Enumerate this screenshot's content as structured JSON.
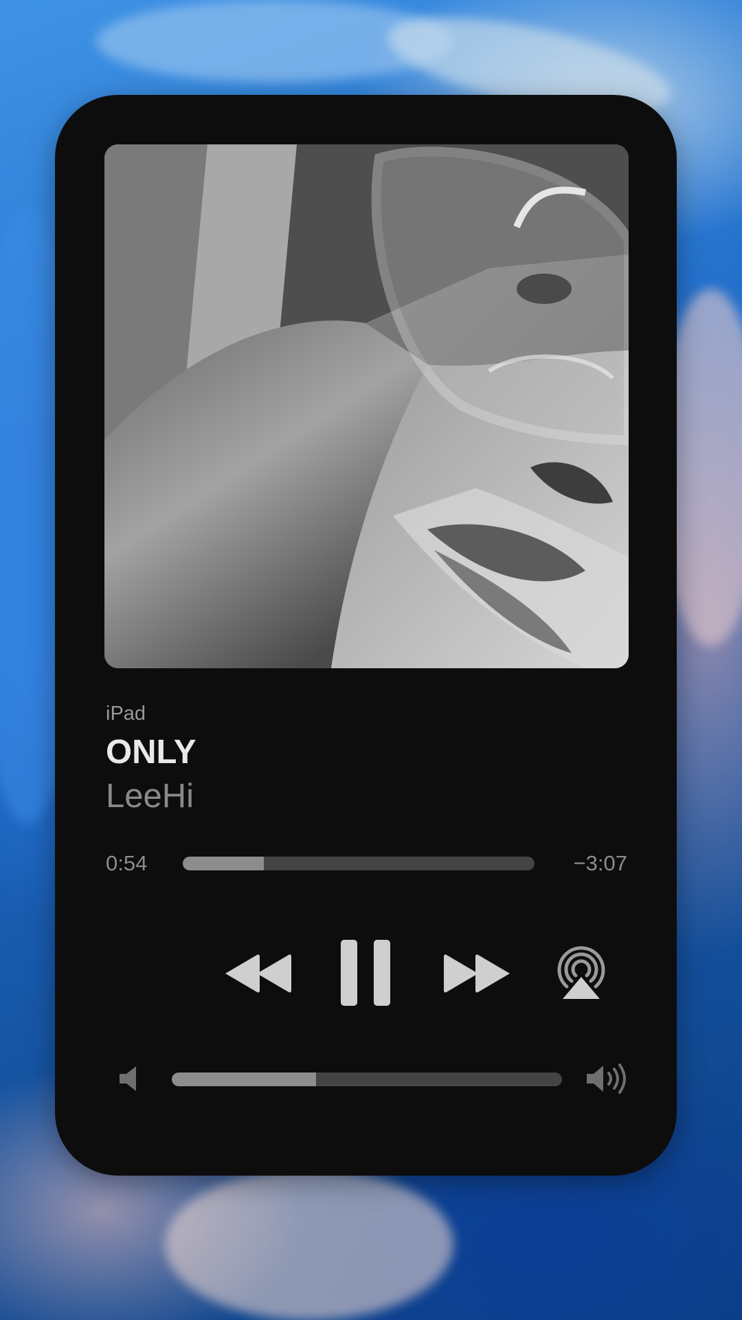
{
  "player": {
    "device_label": "iPad",
    "track_title": "ONLY",
    "artist": "LeeHi",
    "elapsed": "0:54",
    "remaining": "−3:07",
    "progress_fraction": 0.23,
    "volume_fraction": 0.37
  },
  "controls": {
    "rewind_icon": "rewind-icon",
    "pause_icon": "pause-icon",
    "forward_icon": "fast-forward-icon",
    "airplay_icon": "airplay-icon",
    "volume_low_icon": "speaker-low-icon",
    "volume_high_icon": "speaker-high-icon"
  },
  "colors": {
    "card_background": "#0d0d0d",
    "primary_text": "#e9e9e9",
    "secondary_text": "#8a8a8a",
    "track_empty": "#444444",
    "track_fill": "#8d8d8d",
    "icon": "#cfcfcf"
  }
}
